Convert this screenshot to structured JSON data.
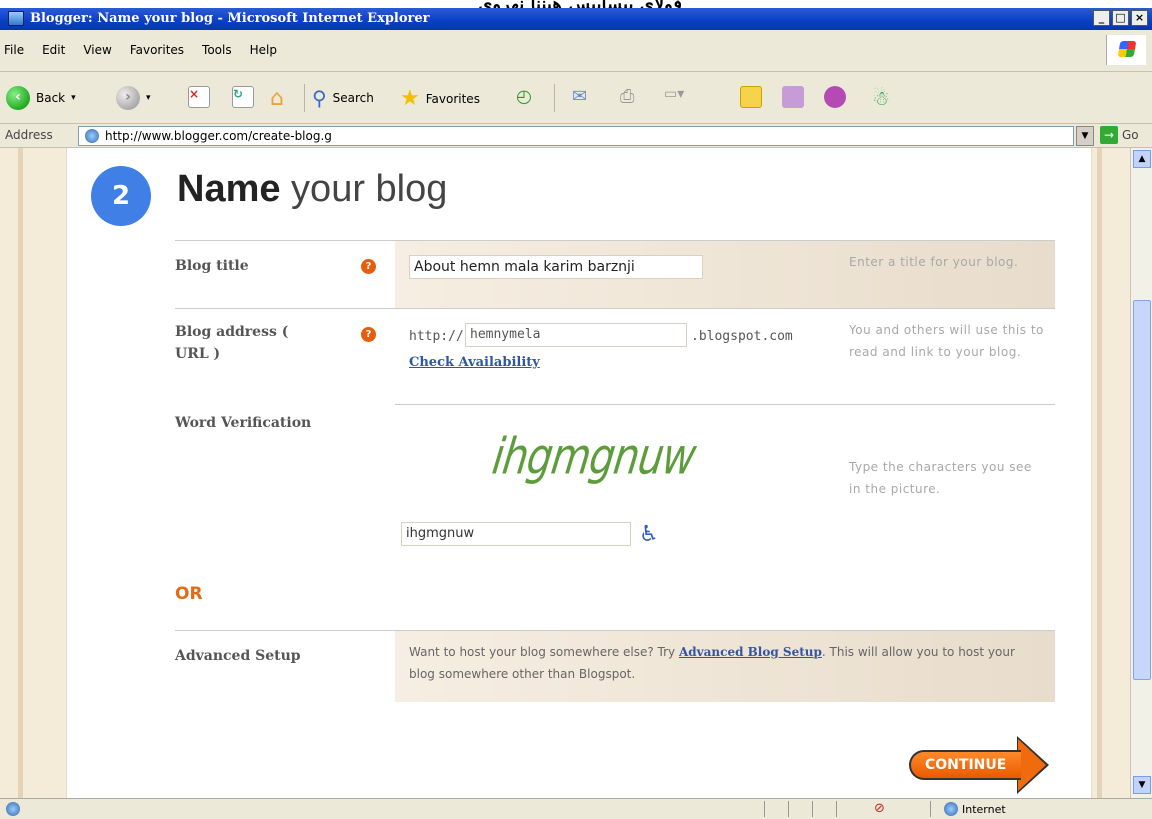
{
  "stray_text": "فولاي بيسابيس هيننا نهروي",
  "window": {
    "title": "Blogger: Name your blog - Microsoft Internet Explorer",
    "controls": [
      "_",
      "□",
      "×"
    ]
  },
  "menu": [
    "File",
    "Edit",
    "View",
    "Favorites",
    "Tools",
    "Help"
  ],
  "toolbar": {
    "back_label": "Back",
    "search_label": "Search",
    "favorites_label": "Favorites"
  },
  "address": {
    "label": "Address",
    "url": "http://www.blogger.com/create-blog.g",
    "go_label": "Go"
  },
  "page": {
    "step_number": "2",
    "heading_bold": "Name",
    "heading_rest": " your blog",
    "blog_title": {
      "label": "Blog title",
      "value": "About hemn mala karim barznji",
      "hint": "Enter a title for your blog."
    },
    "blog_address": {
      "label": "Blog address ( URL )",
      "prefix": "http://",
      "value": "hemnymela",
      "suffix": ".blogspot.com",
      "check_link": "Check Availability",
      "hint": "You and others will use this to read and link to your blog."
    },
    "word_verification": {
      "label": "Word Verification",
      "captcha_text": "ihgmgnuw",
      "input_value": "ihgmgnuw",
      "hint": "Type the characters you see in the picture."
    },
    "or_label": "OR",
    "advanced": {
      "label": "Advanced Setup",
      "text_before": "Want to host your blog somewhere else? Try ",
      "link": "Advanced Blog Setup",
      "text_after": ". This will allow you to host your blog somewhere other than Blogspot."
    },
    "continue_label": "CONTINUE"
  },
  "status": {
    "zone_label": "Internet"
  },
  "colors": {
    "accent_orange": "#e36b16",
    "link_blue": "#3355a6",
    "step_blue": "#3f7fe6",
    "titlebar_blue": "#0a3fc4"
  }
}
